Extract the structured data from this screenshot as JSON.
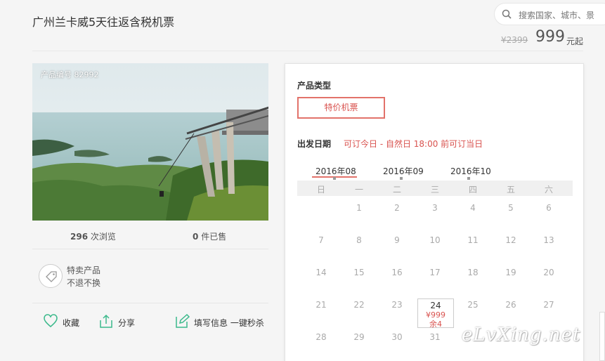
{
  "title": "广州兰卡威5天往返含税机票",
  "search": {
    "placeholder": "搜索国家、城市、景"
  },
  "price": {
    "original": "¥2399",
    "current": "999",
    "unit": "元起"
  },
  "photo": {
    "code": "产品编号 82992"
  },
  "stats": {
    "views_count": "296",
    "views_label": "次浏览",
    "sold_count": "0",
    "sold_label": "件已售"
  },
  "special": {
    "line1": "特卖产品",
    "line2": "不退不换"
  },
  "actions": {
    "favorite": "收藏",
    "share": "分享",
    "fill_buy": "填写信息 一键秒杀"
  },
  "panel": {
    "type_label": "产品类型",
    "type_option": "特价机票",
    "date_label": "出发日期",
    "date_notice": "可订今日 - 自然日 18:00 前可订当日",
    "months": [
      "2016年08",
      "2016年09",
      "2016年10"
    ],
    "weekdays": [
      "日",
      "一",
      "二",
      "三",
      "四",
      "五",
      "六"
    ],
    "days": [
      "1",
      "2",
      "3",
      "4",
      "5",
      "6",
      "7",
      "8",
      "9",
      "10",
      "11",
      "12",
      "13",
      "14",
      "15",
      "16",
      "17",
      "18",
      "19",
      "20",
      "21",
      "22",
      "23",
      "24",
      "25",
      "26",
      "27",
      "28",
      "29",
      "30",
      "31"
    ],
    "selected": {
      "day": "24",
      "price": "¥999",
      "remain": "余4"
    }
  },
  "watermark": "eLvXing.net",
  "colors": {
    "accent": "#d9534f",
    "green_icon": "#3bb98b"
  }
}
